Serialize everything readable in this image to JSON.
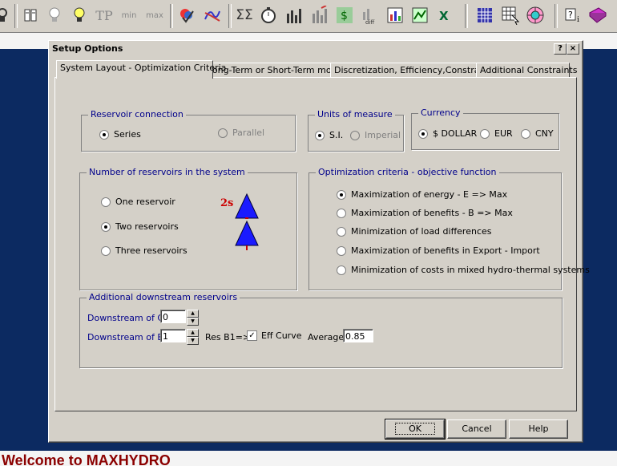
{
  "toolbar": {
    "icons": [
      "stacked-reservoirs-icon",
      "light-bulb-icon",
      "light-bulb-on-icon",
      "tp-icon",
      "min-icon",
      "max-icon",
      "palette-check-icon",
      "curve-icon",
      "sigma-icon",
      "stopwatch-icon",
      "bar-chart-icon",
      "bar-chart-2-icon",
      "dollar-chart-icon",
      "diff-chart-icon",
      "column-chart-icon",
      "line-chart-icon",
      "excel-icon",
      "grid-icon",
      "grid-cursor-icon",
      "globe-grid-icon",
      "help-icon",
      "book-icon"
    ],
    "text_tp": "TP",
    "text_min": "min",
    "text_max": "max",
    "text_sigma": "ΣΣ"
  },
  "dialog": {
    "title": "Setup Options",
    "help_btn": "?",
    "close_btn": "×",
    "tabs": [
      {
        "label": "System Layout - Optimization Criteria",
        "active": true
      },
      {
        "label": "Long-Term or Short-Term mode",
        "active": false
      },
      {
        "label": "Discretization, Efficiency,Constraints",
        "active": false
      },
      {
        "label": "Additional Constraints",
        "active": false
      }
    ],
    "reservoir_connection": {
      "legend": "Reservoir connection",
      "options": [
        {
          "label": "Series",
          "selected": true,
          "enabled": true
        },
        {
          "label": "Parallel",
          "selected": false,
          "enabled": false
        }
      ]
    },
    "units": {
      "legend": "Units of measure",
      "options": [
        {
          "label": "S.I.",
          "selected": true,
          "enabled": true
        },
        {
          "label": "Imperial",
          "selected": false,
          "enabled": false
        }
      ]
    },
    "currency": {
      "legend": "Currency",
      "options": [
        {
          "label": "$ DOLLAR",
          "selected": true
        },
        {
          "label": "EUR",
          "selected": false
        },
        {
          "label": "CNY",
          "selected": false
        }
      ]
    },
    "num_reservoirs": {
      "legend": "Number of reservoirs in the system",
      "options": [
        {
          "label": "One reservoir",
          "selected": false
        },
        {
          "label": "Two reservoirs",
          "selected": true
        },
        {
          "label": "Three reservoirs",
          "selected": false
        }
      ],
      "diagram_label": "2s"
    },
    "optimization": {
      "legend": "Optimization criteria - objective function",
      "options": [
        {
          "label": "Maximization of energy - E => Max",
          "selected": true
        },
        {
          "label": "Maximization of benefits - B => Max",
          "selected": false
        },
        {
          "label": "Minimization of load differences",
          "selected": false
        },
        {
          "label": "Maximization of benefits in Export - Import",
          "selected": false
        },
        {
          "label": "Minimization of costs in mixed hydro-thermal systems",
          "selected": false
        }
      ]
    },
    "downstream": {
      "legend": "Additional downstream reservoirs",
      "c_label": "Downstream of C",
      "c_value": "0",
      "b_label": "Downstream of B",
      "b_value": "1",
      "res_b1_label": "Res B1=>",
      "eff_curve_label": "Eff Curve",
      "eff_curve_checked": true,
      "average_label": "Average",
      "average_value": "0.85"
    },
    "buttons": {
      "ok": "OK",
      "cancel": "Cancel",
      "help": "Help"
    }
  },
  "welcome_text": "Welcome to MAXHYDRO",
  "colors": {
    "desktop_bg": "#0c2a61",
    "dialog_bg": "#d4d0c8",
    "legend_text": "#00008b",
    "welcome_text": "#8b0000",
    "reservoir_triangle": "#1a1aff"
  }
}
